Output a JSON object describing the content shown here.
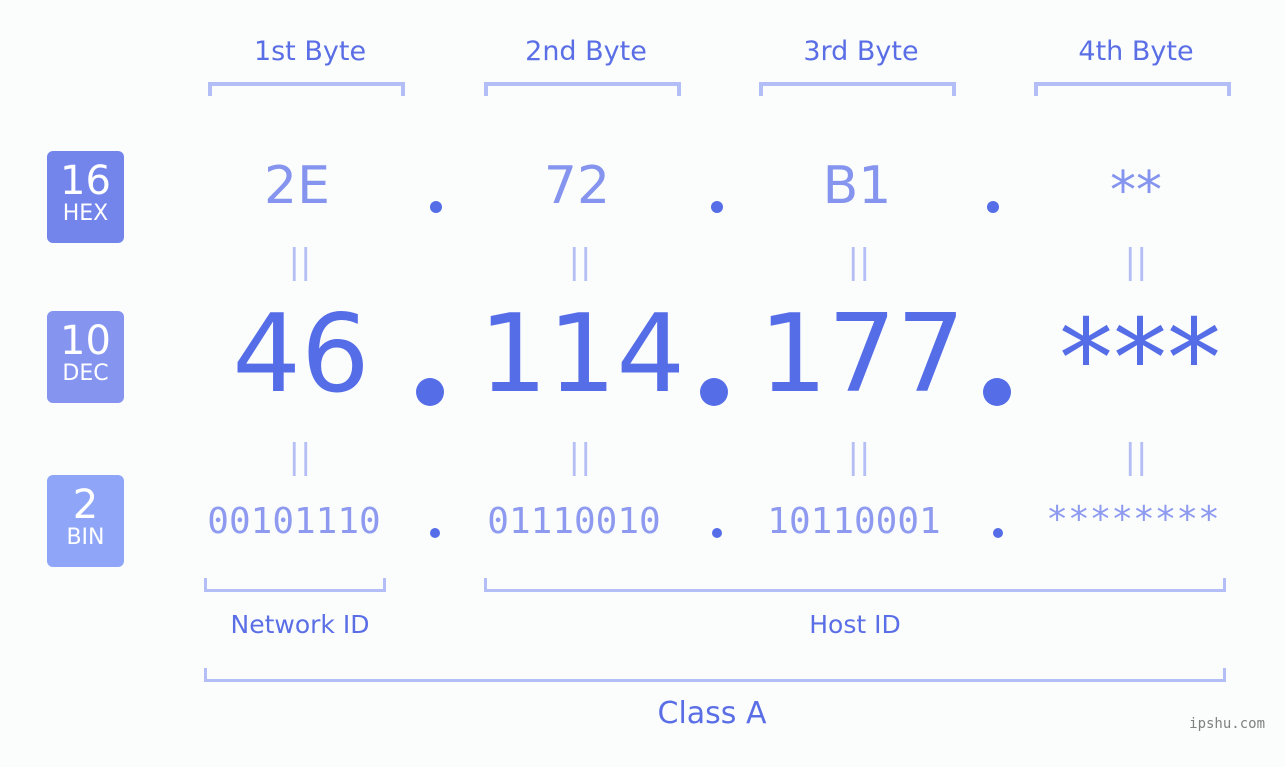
{
  "bytes": [
    {
      "label": "1st Byte",
      "hex": "2E",
      "dec": "46",
      "bin": "00101110"
    },
    {
      "label": "2nd Byte",
      "hex": "72",
      "dec": "114",
      "bin": "01110010"
    },
    {
      "label": "3rd Byte",
      "hex": "B1",
      "dec": "177",
      "bin": "10110001"
    },
    {
      "label": "4th Byte",
      "hex": "**",
      "dec": "***",
      "bin": "********"
    }
  ],
  "bases": {
    "hex": {
      "number": "16",
      "label": "HEX",
      "color": "#7384ea"
    },
    "dec": {
      "number": "10",
      "label": "DEC",
      "color": "#8494ef"
    },
    "bin": {
      "number": "2",
      "label": "BIN",
      "color": "#8fa6f8"
    }
  },
  "equals_sign": "||",
  "segments": {
    "network_id": "Network ID",
    "host_id": "Host ID",
    "class": "Class A"
  },
  "watermark": "ipshu.com",
  "colors": {
    "accent": "#566de8",
    "bracket": "#b3bdf6",
    "background": "#fbfdfc"
  }
}
